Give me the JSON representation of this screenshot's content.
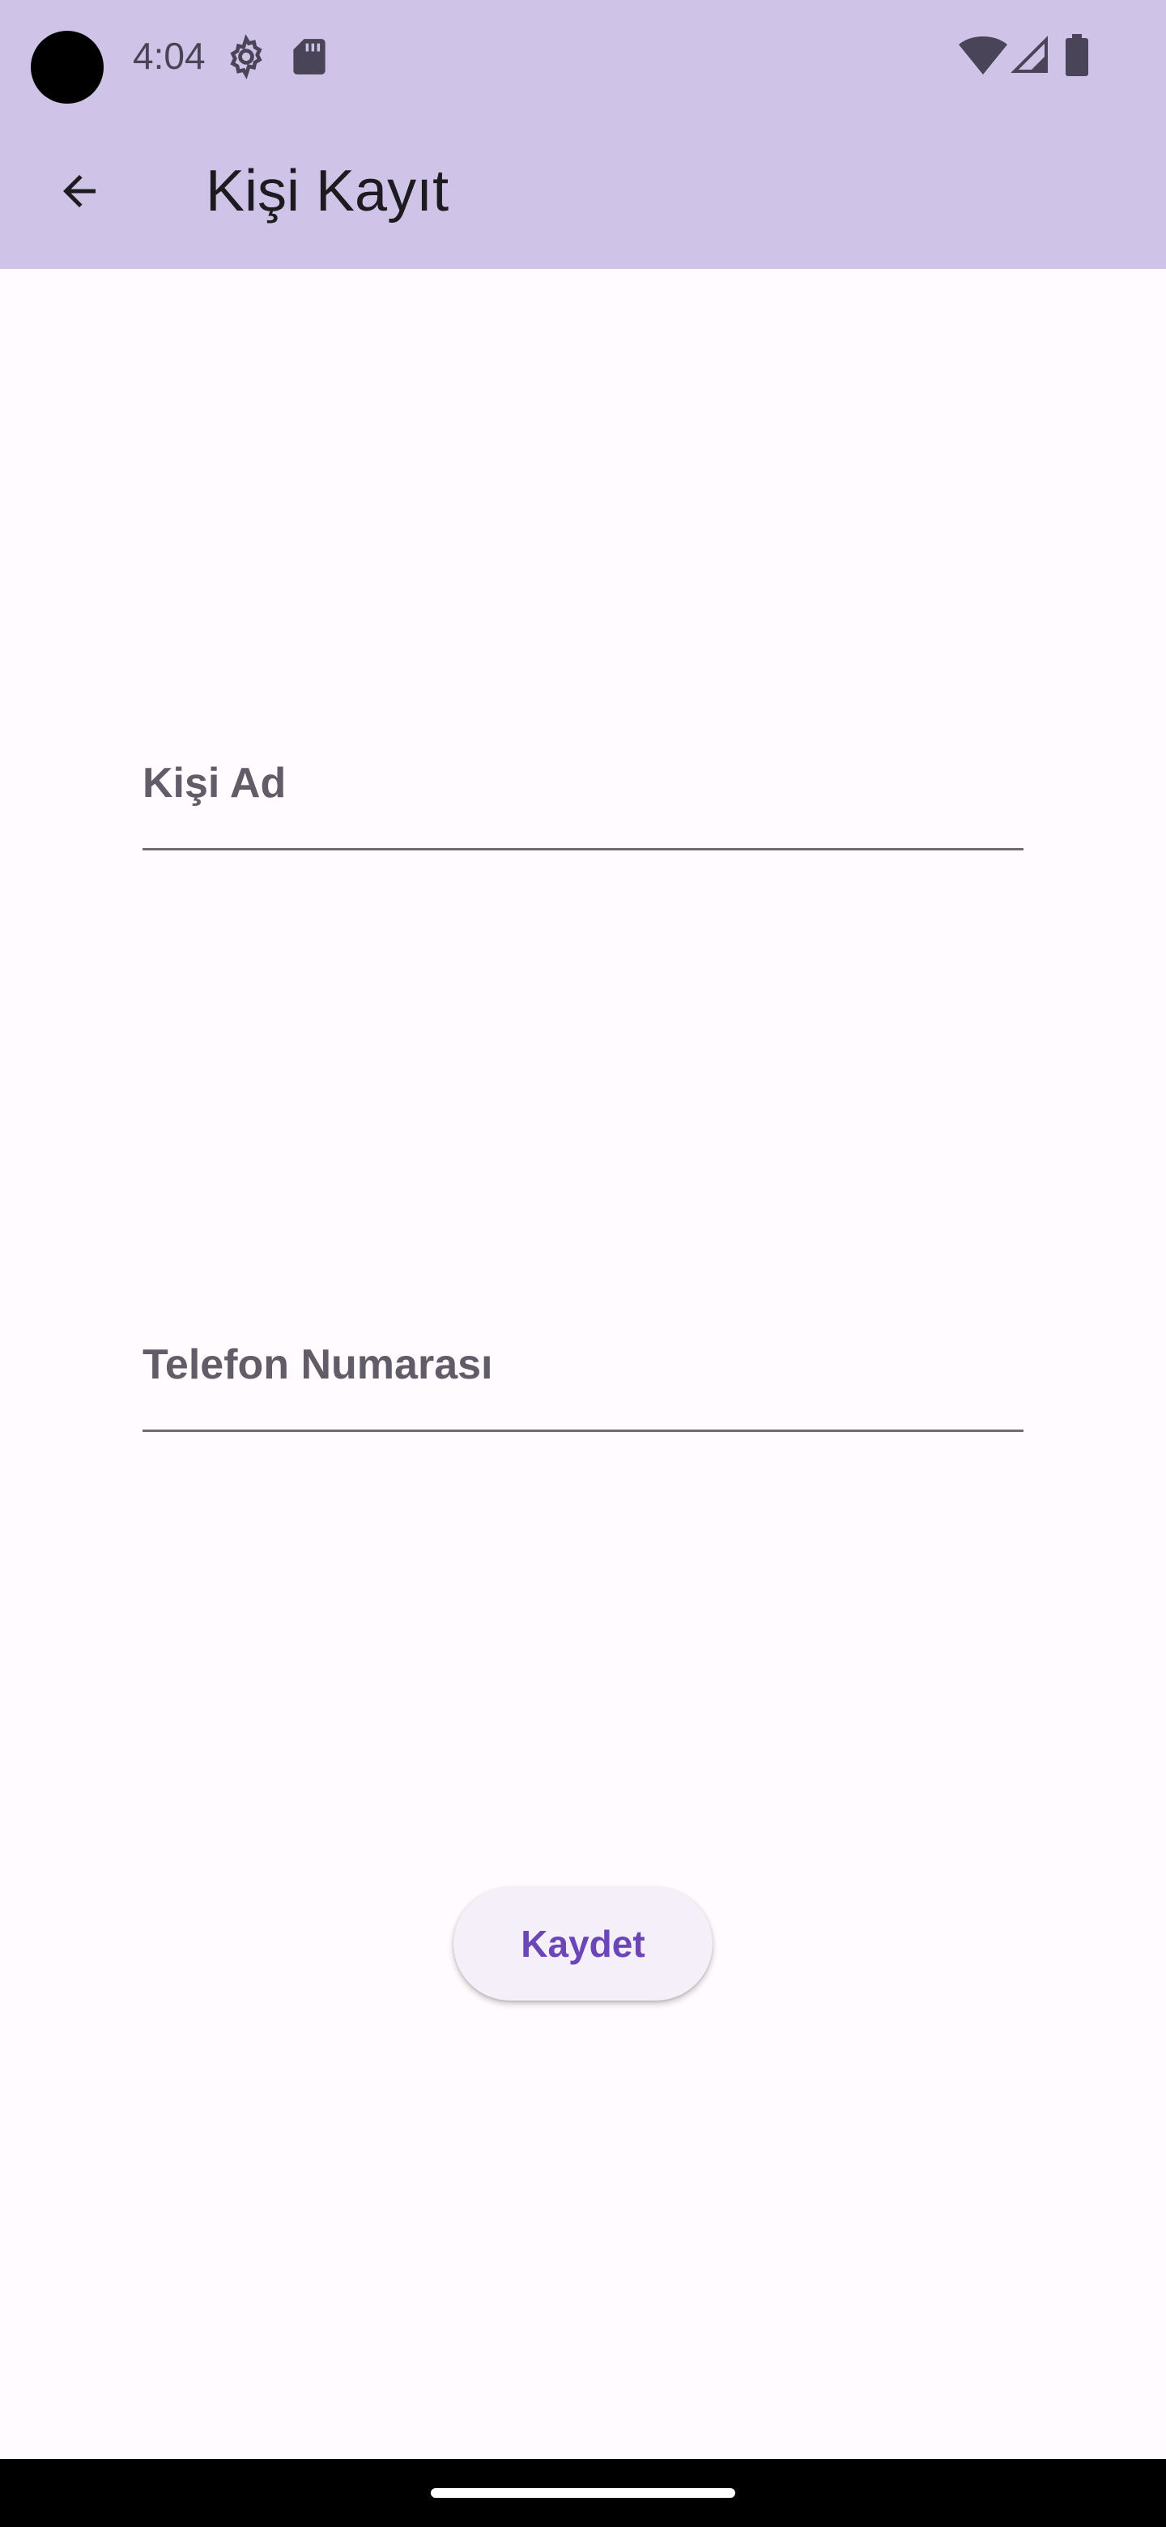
{
  "status_bar": {
    "time": "4:04",
    "icons": [
      "camera-cutout",
      "gear-icon",
      "sdcard-icon",
      "wifi-icon",
      "signal-icon",
      "battery-icon"
    ]
  },
  "app_bar": {
    "back_icon": "arrow-back-icon",
    "title": "Kişi Kayıt",
    "background_color": "#d0c3e8"
  },
  "form": {
    "name_field": {
      "label": "Kişi Ad",
      "value": "",
      "placeholder": ""
    },
    "phone_field": {
      "label": "Telefon Numarası",
      "value": "",
      "placeholder": ""
    }
  },
  "actions": {
    "save_label": "Kaydet",
    "save_color": "#6a46b7"
  },
  "colors": {
    "background": "#fffbfe",
    "field_underline": "#6f6a74",
    "label": "#625c69"
  }
}
